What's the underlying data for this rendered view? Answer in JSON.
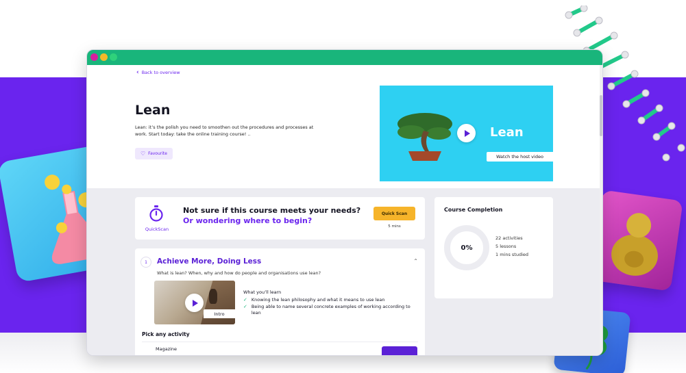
{
  "browser": {
    "back_link": "Back to overview"
  },
  "hero": {
    "title": "Lean",
    "description": "Lean: it’s the polish you need to smoothen out the procedures and processes at work. Start today: take the online training course! ..",
    "favourite_label": "Favourite",
    "video": {
      "title": "Lean",
      "host_video_label": "Watch the host video"
    }
  },
  "quickscan": {
    "label": "QuickScan",
    "question_line1": "Not sure if this course meets your needs?",
    "question_line2": "Or wondering where to begin?",
    "button_label": "Quick Scan",
    "duration": "5 mins"
  },
  "completion": {
    "title": "Course Completion",
    "percent": "0%",
    "stats": [
      "22 activities",
      "5 lessons",
      "1 mins studied"
    ]
  },
  "lesson": {
    "number": "1",
    "title": "Achieve More, Doing Less",
    "subtitle": "What is lean? When, why and how do people and organisations use lean?",
    "video_tag": "Intro",
    "learn_title": "What you’ll learn",
    "learn_items": [
      "Knowing the lean philosophy and what it means to use lean",
      "Being able to name several concrete examples of working according to lean"
    ],
    "pick_title": "Pick any activity",
    "activities": [
      {
        "name": "Magazine"
      }
    ]
  },
  "icons": {
    "back": "chevron-left-icon",
    "favourite": "heart-icon",
    "play": "play-icon",
    "quickscan": "stopwatch-icon",
    "collapse": "chevron-up-icon",
    "check": "check-icon"
  },
  "colors": {
    "accent": "#6a24ee",
    "titlebar": "#19b57b",
    "video_bg": "#2ed0f2",
    "quickscan_button": "#f6b42a",
    "check": "#19b57b"
  }
}
